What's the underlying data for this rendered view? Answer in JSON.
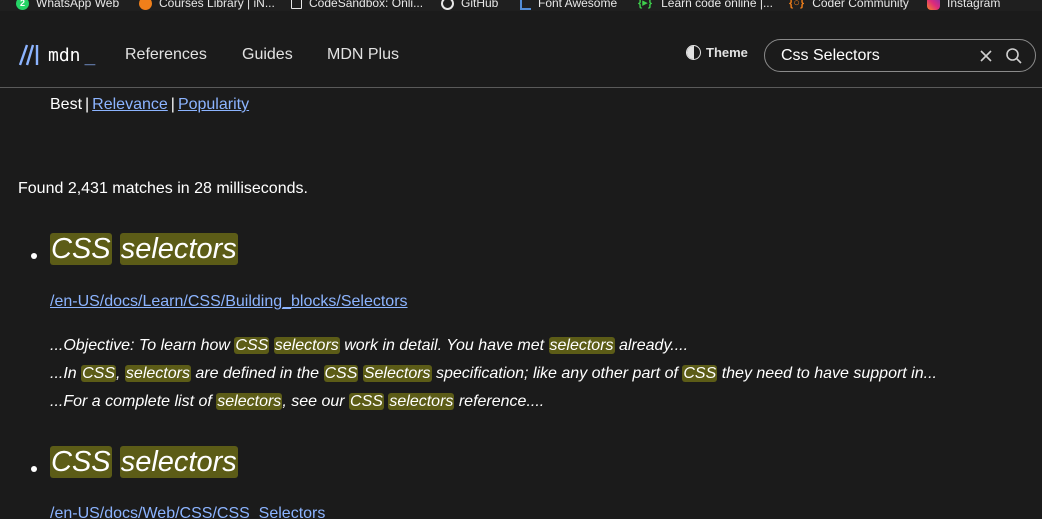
{
  "bookmarks": [
    {
      "label": "WhatsApp Web",
      "icon": "whatsapp-icon",
      "badge": "2",
      "color": "#25d366"
    },
    {
      "label": "Courses Library | iN...",
      "icon": "courses-icon",
      "color": "#f07f1a"
    },
    {
      "label": "CodeSandbox: Onli...",
      "icon": "codesandbox-icon",
      "color": "#e8e8e8"
    },
    {
      "label": "GitHub",
      "icon": "github-icon",
      "color": "#e8e8e8"
    },
    {
      "label": "Font Awesome",
      "icon": "fontawesome-icon",
      "color": "#538dd7"
    },
    {
      "label": "Learn code online |...",
      "icon": "learn-code-icon",
      "color": "#3ecf4c"
    },
    {
      "label": "Coder Community",
      "icon": "coder-community-icon",
      "color": "#f07f1a"
    },
    {
      "label": "Instagram",
      "icon": "instagram-icon",
      "color": "#e1306c"
    }
  ],
  "header": {
    "logo_text": "mdn",
    "logo_cursor": "_",
    "nav": [
      "References",
      "Guides",
      "MDN Plus"
    ],
    "theme_label": "Theme",
    "search_value": "Css Selectors"
  },
  "sort": {
    "current": "Best",
    "options": [
      "Relevance",
      "Popularity"
    ]
  },
  "found_text": "Found 2,431 matches in 28 milliseconds.",
  "results": [
    {
      "title_words": [
        "CSS",
        "selectors"
      ],
      "url": "/en-US/docs/Learn/CSS/Building_blocks/Selectors",
      "snippets": [
        [
          {
            "t": "...Objective: To learn how ",
            "h": false
          },
          {
            "t": "CSS",
            "h": true
          },
          {
            "t": " ",
            "h": false
          },
          {
            "t": "selectors",
            "h": true
          },
          {
            "t": " work in detail. You have met ",
            "h": false
          },
          {
            "t": "selectors",
            "h": true
          },
          {
            "t": " already....",
            "h": false
          }
        ],
        [
          {
            "t": "...In ",
            "h": false
          },
          {
            "t": "CSS",
            "h": true
          },
          {
            "t": ", ",
            "h": false
          },
          {
            "t": "selectors",
            "h": true
          },
          {
            "t": " are defined in the ",
            "h": false
          },
          {
            "t": "CSS",
            "h": true
          },
          {
            "t": " ",
            "h": false
          },
          {
            "t": "Selectors",
            "h": true
          },
          {
            "t": " specification; like any other part of ",
            "h": false
          },
          {
            "t": "CSS",
            "h": true
          },
          {
            "t": " they need to have support in...",
            "h": false
          }
        ],
        [
          {
            "t": "...For a complete list of ",
            "h": false
          },
          {
            "t": "selectors",
            "h": true
          },
          {
            "t": ", see our ",
            "h": false
          },
          {
            "t": "CSS",
            "h": true
          },
          {
            "t": " ",
            "h": false
          },
          {
            "t": "selectors",
            "h": true
          },
          {
            "t": " reference....",
            "h": false
          }
        ]
      ]
    },
    {
      "title_words": [
        "CSS",
        "selectors"
      ],
      "url": "/en-US/docs/Web/CSS/CSS_Selectors",
      "snippets": []
    }
  ],
  "colors": {
    "background": "#1b1b1b",
    "link": "#8cb4ff",
    "highlight": "#5c5c17"
  }
}
